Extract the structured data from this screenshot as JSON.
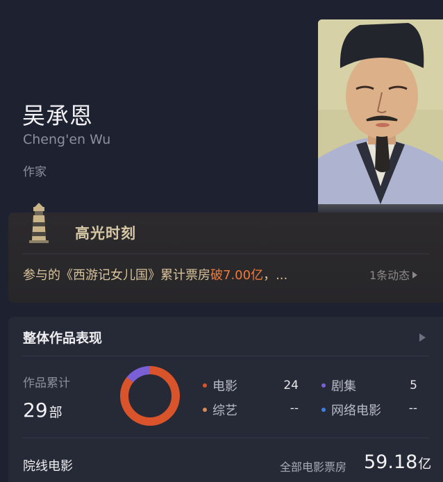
{
  "person": {
    "name": "吴承恩",
    "english_name": "Cheng'en Wu",
    "role": "作家"
  },
  "highlight": {
    "title": "高光时刻",
    "text_prefix": "参与的《西游记女儿国》累计票房",
    "text_accent": "破7.00亿",
    "text_suffix": "，...",
    "more_label": "1条动态",
    "accent_color": "#f07a3a"
  },
  "overview": {
    "title": "整体作品表现",
    "works_label": "作品累计",
    "works_count": "29",
    "works_unit": "部",
    "donut": {
      "movie_fraction": 0.857,
      "drama_fraction": 0.143,
      "movie_color": "#d9542a",
      "drama_color": "#7b5fd6"
    },
    "legend": [
      {
        "label": "电影",
        "value": "24",
        "color": "#d9542a"
      },
      {
        "label": "剧集",
        "value": "5",
        "color": "#7b5fd6"
      },
      {
        "label": "综艺",
        "value": "--",
        "color": "#d88a5a"
      },
      {
        "label": "网络电影",
        "value": "--",
        "color": "#3d7ee0"
      }
    ],
    "cinema_label": "院线电影",
    "box_office_label": "全部电影票房",
    "box_office_value": "59.18",
    "box_office_unit": "亿"
  }
}
